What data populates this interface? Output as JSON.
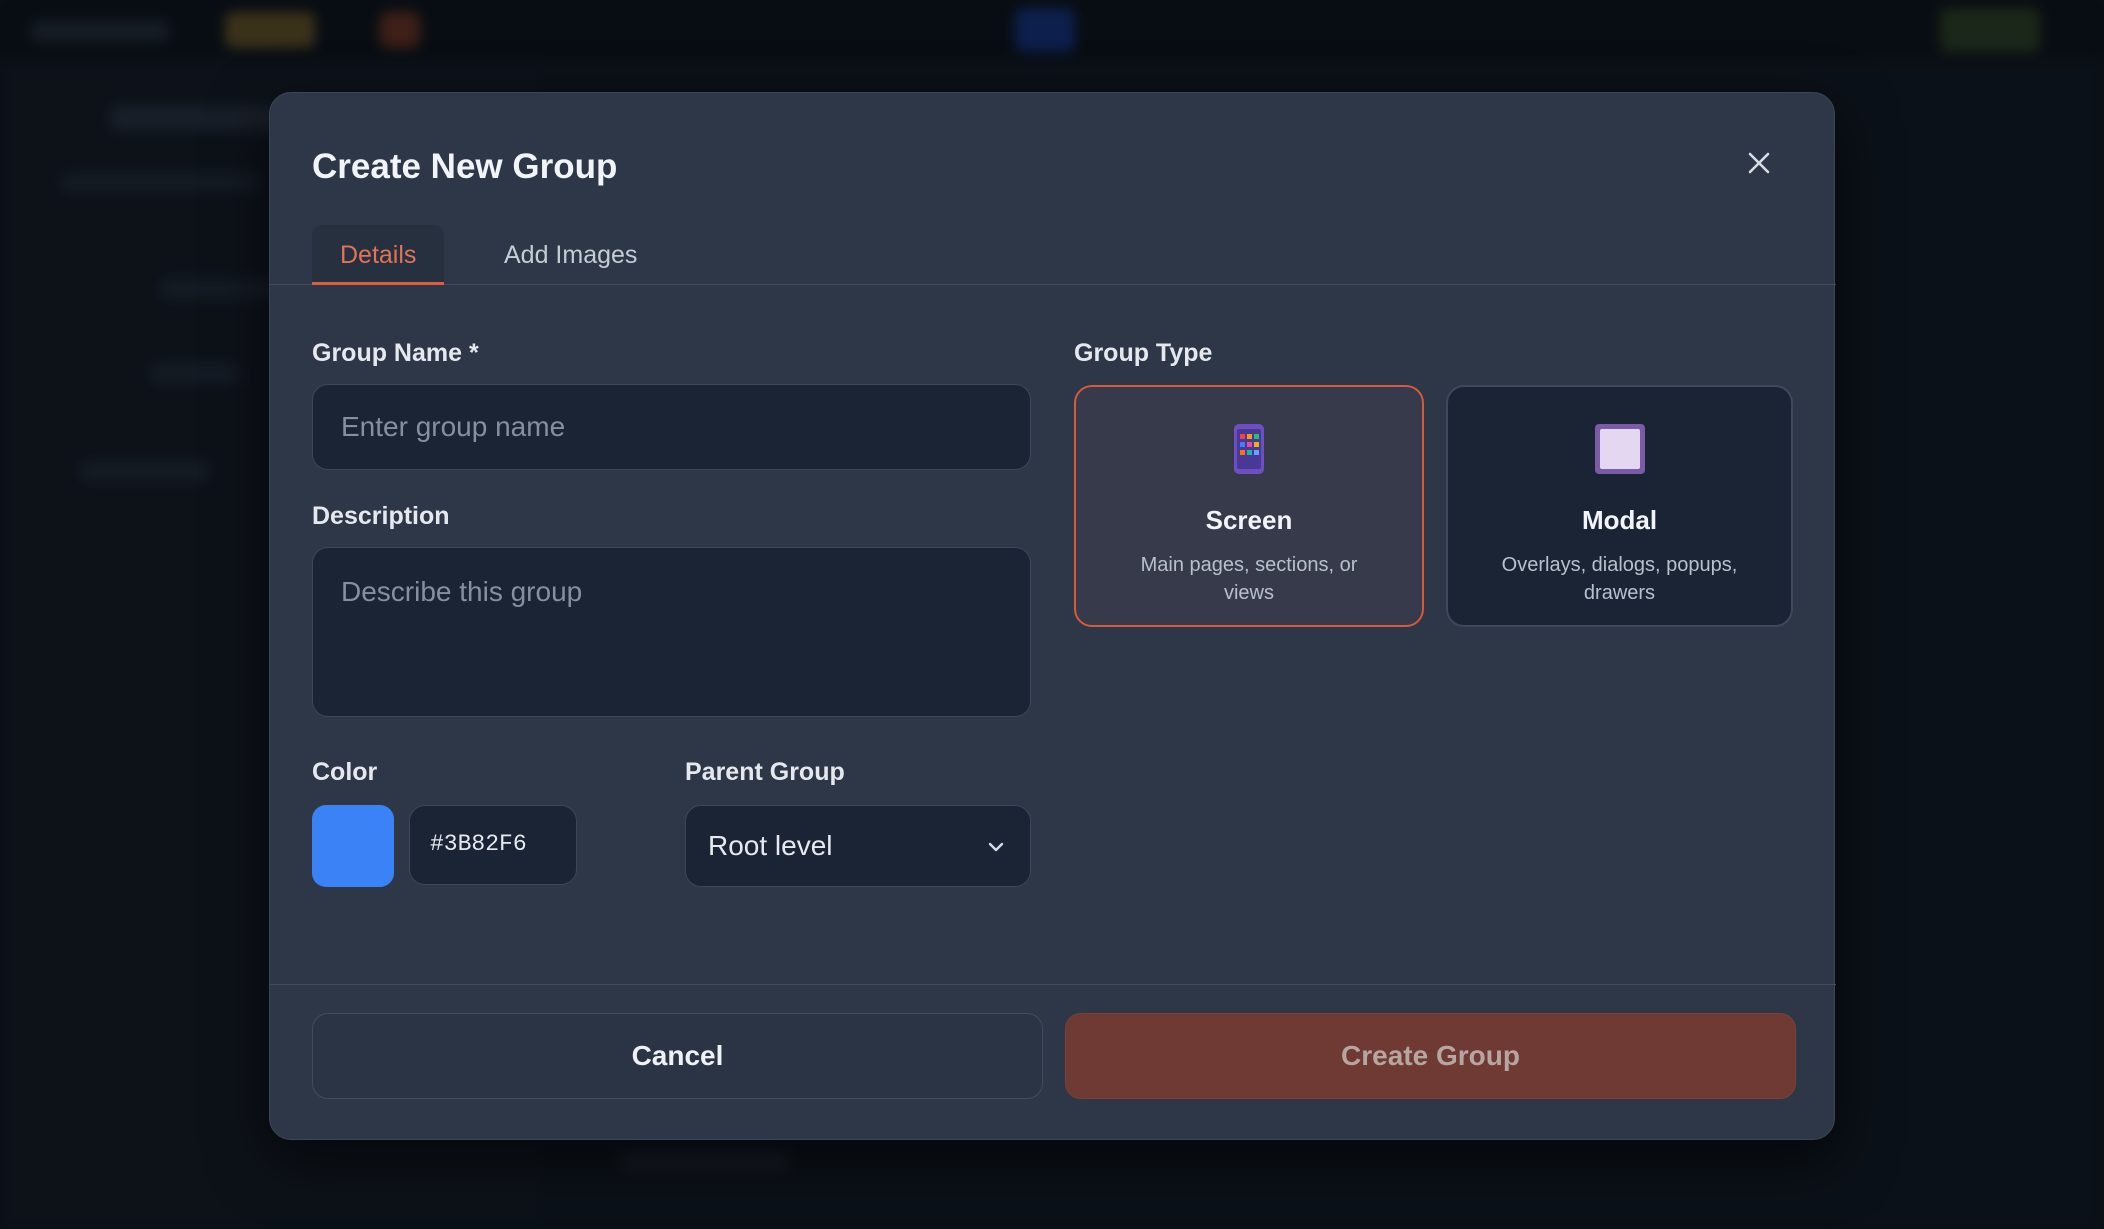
{
  "modal": {
    "title": "Create New Group",
    "close_icon": "close-icon"
  },
  "tabs": [
    {
      "label": "Details",
      "active": true
    },
    {
      "label": "Add Images",
      "active": false
    }
  ],
  "form": {
    "group_name": {
      "label": "Group Name *",
      "placeholder": "Enter group name",
      "value": ""
    },
    "description": {
      "label": "Description",
      "placeholder": "Describe this group",
      "value": ""
    },
    "color": {
      "label": "Color",
      "value": "#3B82F6"
    },
    "parent_group": {
      "label": "Parent Group",
      "selected": "Root level",
      "icon": "chevron-down-icon"
    }
  },
  "group_type": {
    "label": "Group Type",
    "options": [
      {
        "name": "Screen",
        "description": "Main pages, sections, or views",
        "icon": "phone-grid-icon",
        "selected": true
      },
      {
        "name": "Modal",
        "description": "Overlays, dialogs, popups, drawers",
        "icon": "square-window-icon",
        "selected": false
      }
    ]
  },
  "actions": {
    "cancel_label": "Cancel",
    "create_label": "Create Group"
  },
  "colors": {
    "accent": "#D6603F",
    "swatch": "#3B82F6",
    "create_button_bg": "#6E3A33"
  }
}
